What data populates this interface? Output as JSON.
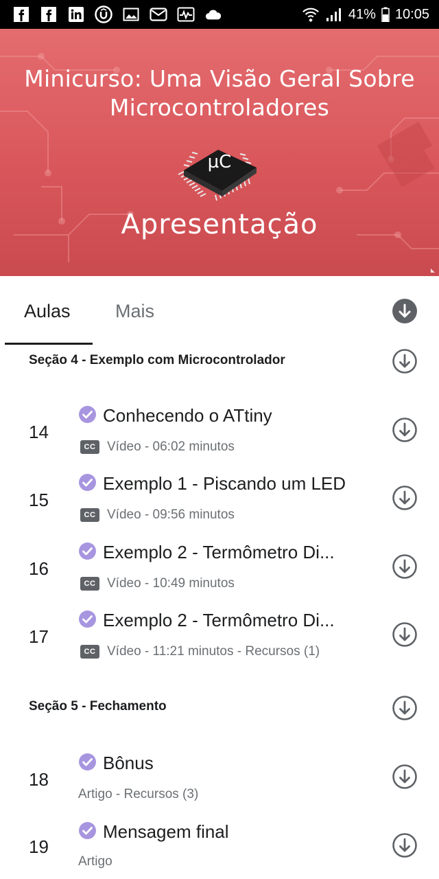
{
  "status_bar": {
    "icons": [
      "facebook-icon",
      "facebook-icon",
      "linkedin-icon",
      "udemy-icon",
      "image-icon",
      "email-icon",
      "activity-icon",
      "cloud-icon",
      "wifi-icon",
      "signal-icon"
    ],
    "battery": "41%",
    "time": "10:05"
  },
  "hero": {
    "title_line1": "Minicurso: Uma Visão Geral Sobre",
    "title_line2": "Microcontroladores",
    "chip_label": "µC",
    "subtitle": "Apresentação"
  },
  "tabs": {
    "aulas": "Aulas",
    "mais": "Mais"
  },
  "sections": [
    {
      "title": "Seção 4 - Exemplo com Microcontrolador",
      "lessons": [
        {
          "number": "14",
          "title": "Conhecendo o ATtiny",
          "cc": "CC",
          "meta": "Vídeo - 06:02 minutos"
        },
        {
          "number": "15",
          "title": "Exemplo 1 - Piscando um LED",
          "cc": "CC",
          "meta": "Vídeo - 09:56 minutos"
        },
        {
          "number": "16",
          "title": "Exemplo 2 - Termômetro Di...",
          "cc": "CC",
          "meta": "Vídeo - 10:49 minutos"
        },
        {
          "number": "17",
          "title": "Exemplo 2 - Termômetro Di...",
          "cc": "CC",
          "meta": "Vídeo - 11:21 minutos - Recursos (1)"
        }
      ]
    },
    {
      "title": "Seção 5 - Fechamento",
      "lessons": [
        {
          "number": "18",
          "title": "Bônus",
          "meta": "Artigo - Recursos (3)"
        },
        {
          "number": "19",
          "title": "Mensagem final",
          "meta": "Artigo"
        }
      ]
    }
  ],
  "colors": {
    "hero": "#d9575b",
    "check": "#a895e0",
    "icon_gray": "#6a6f73",
    "download_all_fill": "#5e6266"
  }
}
